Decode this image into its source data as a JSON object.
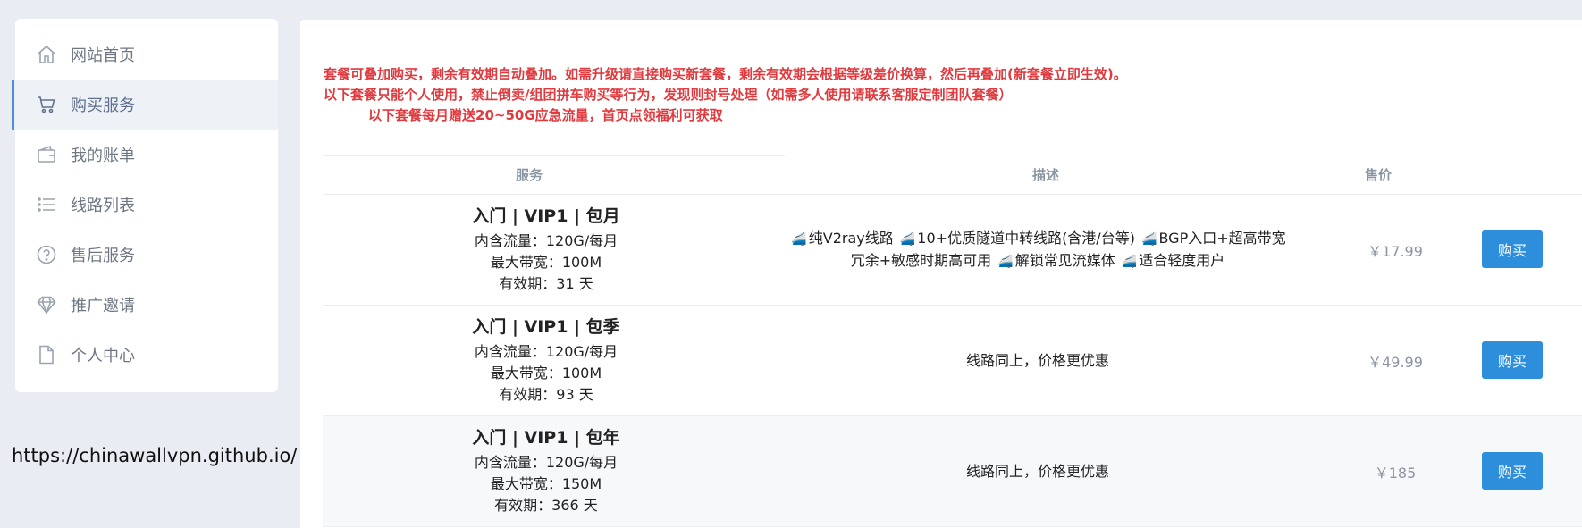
{
  "sidebar": {
    "items": [
      {
        "label": "网站首页",
        "icon": "home-icon"
      },
      {
        "label": "购买服务",
        "icon": "cart-icon"
      },
      {
        "label": "我的账单",
        "icon": "wallet-icon"
      },
      {
        "label": "线路列表",
        "icon": "list-icon"
      },
      {
        "label": "售后服务",
        "icon": "help-icon"
      },
      {
        "label": "推广邀请",
        "icon": "diamond-icon"
      },
      {
        "label": "个人中心",
        "icon": "file-icon"
      }
    ],
    "active_index": 1
  },
  "footer_url": "https://chinawallvpn.github.io/",
  "notice": {
    "line1": "套餐可叠加购买，剩余有效期自动叠加。如需升级请直接购买新套餐，剩余有效期会根据等级差价换算，然后再叠加(新套餐立即生效)。",
    "line2": "以下套餐只能个人使用，禁止倒卖/组团拼车购买等行为，发现则封号处理（如需多人使用请联系客服定制团队套餐）",
    "line3": "以下套餐每月赠送20~50G应急流量，首页点领福利可获取"
  },
  "table": {
    "headers": {
      "service": "服务",
      "desc": "描述",
      "price": "售价"
    },
    "rows": [
      {
        "name": "入门 | VIP1 | 包月",
        "traffic": "内含流量：120G/每月",
        "bandwidth": "最大带宽：100M",
        "validity": "有效期：31 天",
        "desc_parts": [
          "纯V2ray线路",
          "10+优质隧道中转线路(含港/台等)",
          "BGP入口+超高带宽冗余+敏感时期高可用",
          "解锁常见流媒体",
          "适合轻度用户"
        ],
        "price": "￥17.99",
        "buy_label": "购买"
      },
      {
        "name": "入门 | VIP1 | 包季",
        "traffic": "内含流量：120G/每月",
        "bandwidth": "最大带宽：100M",
        "validity": "有效期：93 天",
        "desc": "线路同上，价格更优惠",
        "price": "￥49.99",
        "buy_label": "购买"
      },
      {
        "name": "入门 | VIP1 | 包年",
        "traffic": "内含流量：120G/每月",
        "bandwidth": "最大带宽：150M",
        "validity": "有效期：366 天",
        "desc": "线路同上，价格更优惠",
        "price": "￥185",
        "buy_label": "购买"
      }
    ]
  },
  "colors": {
    "accent": "#2d8fdb",
    "notice": "#e0393e",
    "background": "#e9ecf3"
  }
}
